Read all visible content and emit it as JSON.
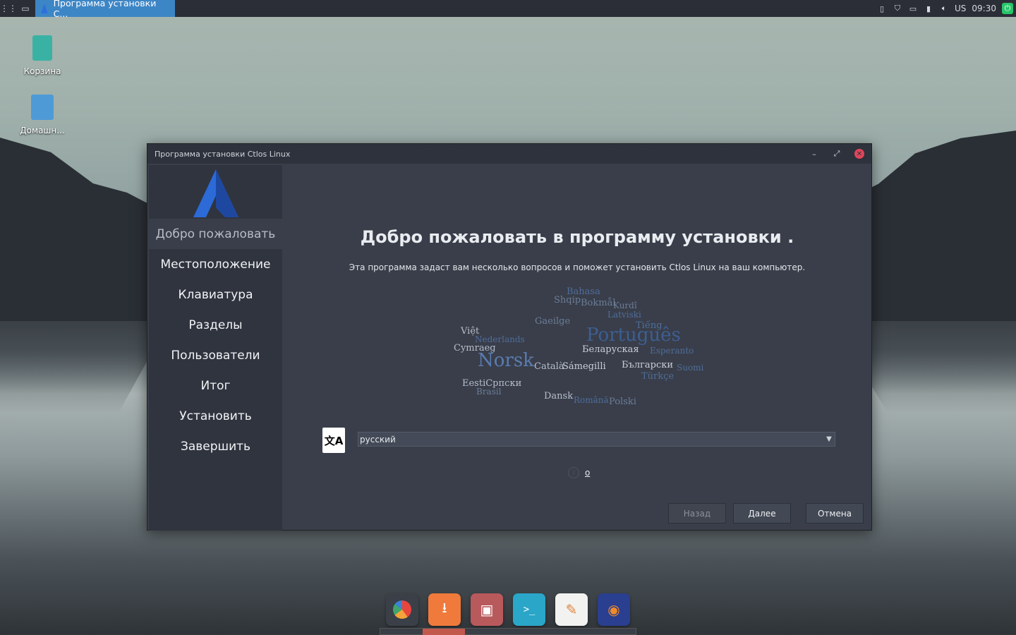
{
  "panel": {
    "task_title": "Программа установки С...",
    "keyboard_layout": "US",
    "clock": "09:30"
  },
  "desktop": {
    "icons": [
      {
        "label": "Корзина"
      },
      {
        "label": "Домашн..."
      }
    ]
  },
  "installer": {
    "window_title": "Программа установки Ctlos Linux",
    "steps": [
      {
        "label": "Добро пожаловать",
        "active": true
      },
      {
        "label": "Местоположение"
      },
      {
        "label": "Клавиатура"
      },
      {
        "label": "Разделы"
      },
      {
        "label": "Пользователи"
      },
      {
        "label": "Итог"
      },
      {
        "label": "Установить"
      },
      {
        "label": "Завершить"
      }
    ],
    "heading": "Добро пожаловать в программу установки .",
    "subtitle": "Эта программа задаст вам несколько вопросов и поможет установить Ctlos Linux на ваш компьютер.",
    "language_select": {
      "value": "русский"
    },
    "info_link": "o",
    "buttons": {
      "back": "Назад",
      "next": "Далее",
      "cancel": "Отмена"
    },
    "word_cloud": [
      "Bahasa",
      "Shqip",
      "Bokmål",
      "Kurdî",
      "Việt",
      "Gaeilge",
      "Latviski",
      "Tiếng",
      "Português",
      "Nederlands",
      "Cymraeg",
      "Беларуская",
      "Esperanto",
      "Norsk",
      "Català",
      "Sámegilli",
      "Български",
      "Suomi",
      "EestiСрпски",
      "Türkçe",
      "Dansk",
      "Română",
      "Polski",
      "Brasil"
    ]
  },
  "dock": {
    "apps": [
      "chart-icon",
      "download-icon",
      "files-icon",
      "terminal-icon",
      "editor-icon",
      "firefox-icon"
    ]
  }
}
